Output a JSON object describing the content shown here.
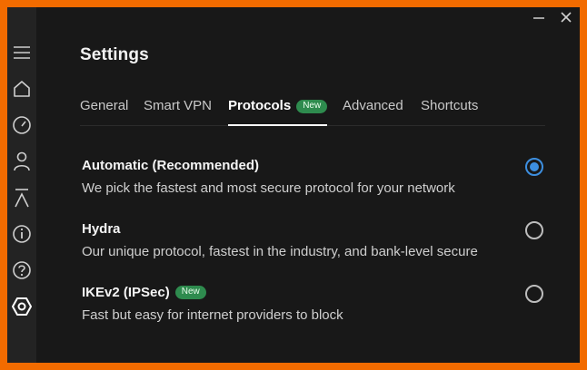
{
  "page": {
    "title": "Settings"
  },
  "window_controls": {
    "minimize_icon": "minimize-icon",
    "close_icon": "close-icon"
  },
  "sidebar": {
    "items": [
      {
        "icon": "menu-icon",
        "label": ""
      },
      {
        "icon": "home-icon",
        "label": ""
      },
      {
        "icon": "speedometer-icon",
        "label": ""
      },
      {
        "icon": "user-icon",
        "label": ""
      },
      {
        "icon": "lambda-icon",
        "label": ""
      },
      {
        "icon": "info-icon",
        "label": ""
      },
      {
        "icon": "help-icon",
        "label": ""
      },
      {
        "icon": "settings-hexagon-icon",
        "label": "",
        "active": true
      }
    ]
  },
  "tabs": [
    {
      "label": "General",
      "active": false
    },
    {
      "label": "Smart VPN",
      "active": false
    },
    {
      "label": "Protocols",
      "active": true,
      "badge": "New"
    },
    {
      "label": "Advanced",
      "active": false
    },
    {
      "label": "Shortcuts",
      "active": false
    }
  ],
  "protocols": [
    {
      "title": "Automatic (Recommended)",
      "description": "We pick the fastest and most secure protocol for your network",
      "selected": true
    },
    {
      "title": "Hydra",
      "description": "Our unique protocol, fastest in the industry, and bank-level secure",
      "selected": false
    },
    {
      "title": "IKEv2 (IPSec)",
      "badge": "New",
      "description": "Fast but easy for internet providers to block",
      "selected": false
    }
  ],
  "colors": {
    "frame": "#f26b00",
    "background": "#181818",
    "sidebar": "#232323",
    "accent": "#3d8fe0",
    "badge": "#2e8b4e"
  }
}
